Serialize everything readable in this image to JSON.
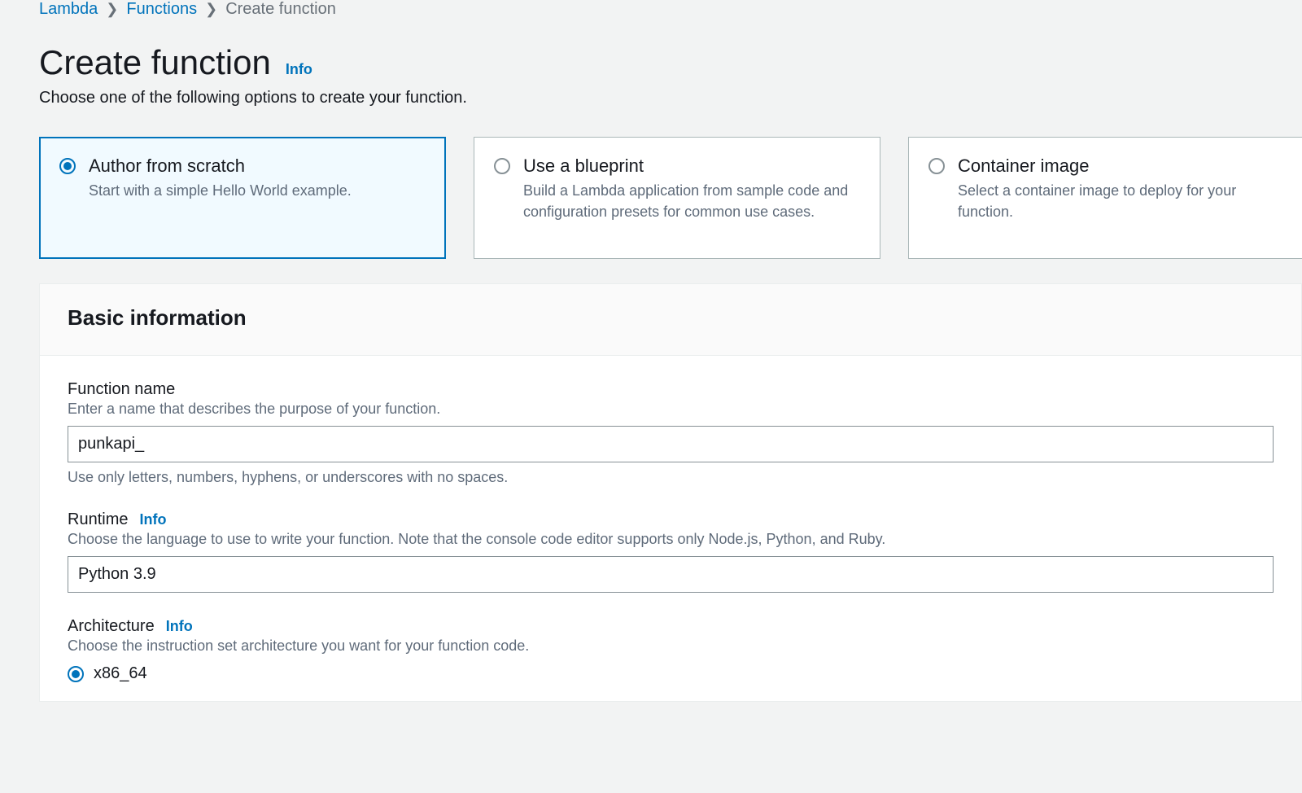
{
  "breadcrumb": {
    "items": [
      {
        "label": "Lambda",
        "link": true
      },
      {
        "label": "Functions",
        "link": true
      },
      {
        "label": "Create function",
        "link": false
      }
    ]
  },
  "header": {
    "title": "Create function",
    "info": "Info",
    "subtitle": "Choose one of the following options to create your function."
  },
  "options": [
    {
      "title": "Author from scratch",
      "desc": "Start with a simple Hello World example.",
      "selected": true
    },
    {
      "title": "Use a blueprint",
      "desc": "Build a Lambda application from sample code and configuration presets for common use cases.",
      "selected": false
    },
    {
      "title": "Container image",
      "desc": "Select a container image to deploy for your function.",
      "selected": false
    }
  ],
  "basic": {
    "heading": "Basic information",
    "functionName": {
      "label": "Function name",
      "help": "Enter a name that describes the purpose of your function.",
      "value": "punkapi_",
      "hint": "Use only letters, numbers, hyphens, or underscores with no spaces."
    },
    "runtime": {
      "label": "Runtime",
      "info": "Info",
      "help": "Choose the language to use to write your function. Note that the console code editor supports only Node.js, Python, and Ruby.",
      "value": "Python 3.9"
    },
    "architecture": {
      "label": "Architecture",
      "info": "Info",
      "help": "Choose the instruction set architecture you want for your function code.",
      "options": [
        {
          "label": "x86_64",
          "selected": true
        }
      ]
    }
  }
}
